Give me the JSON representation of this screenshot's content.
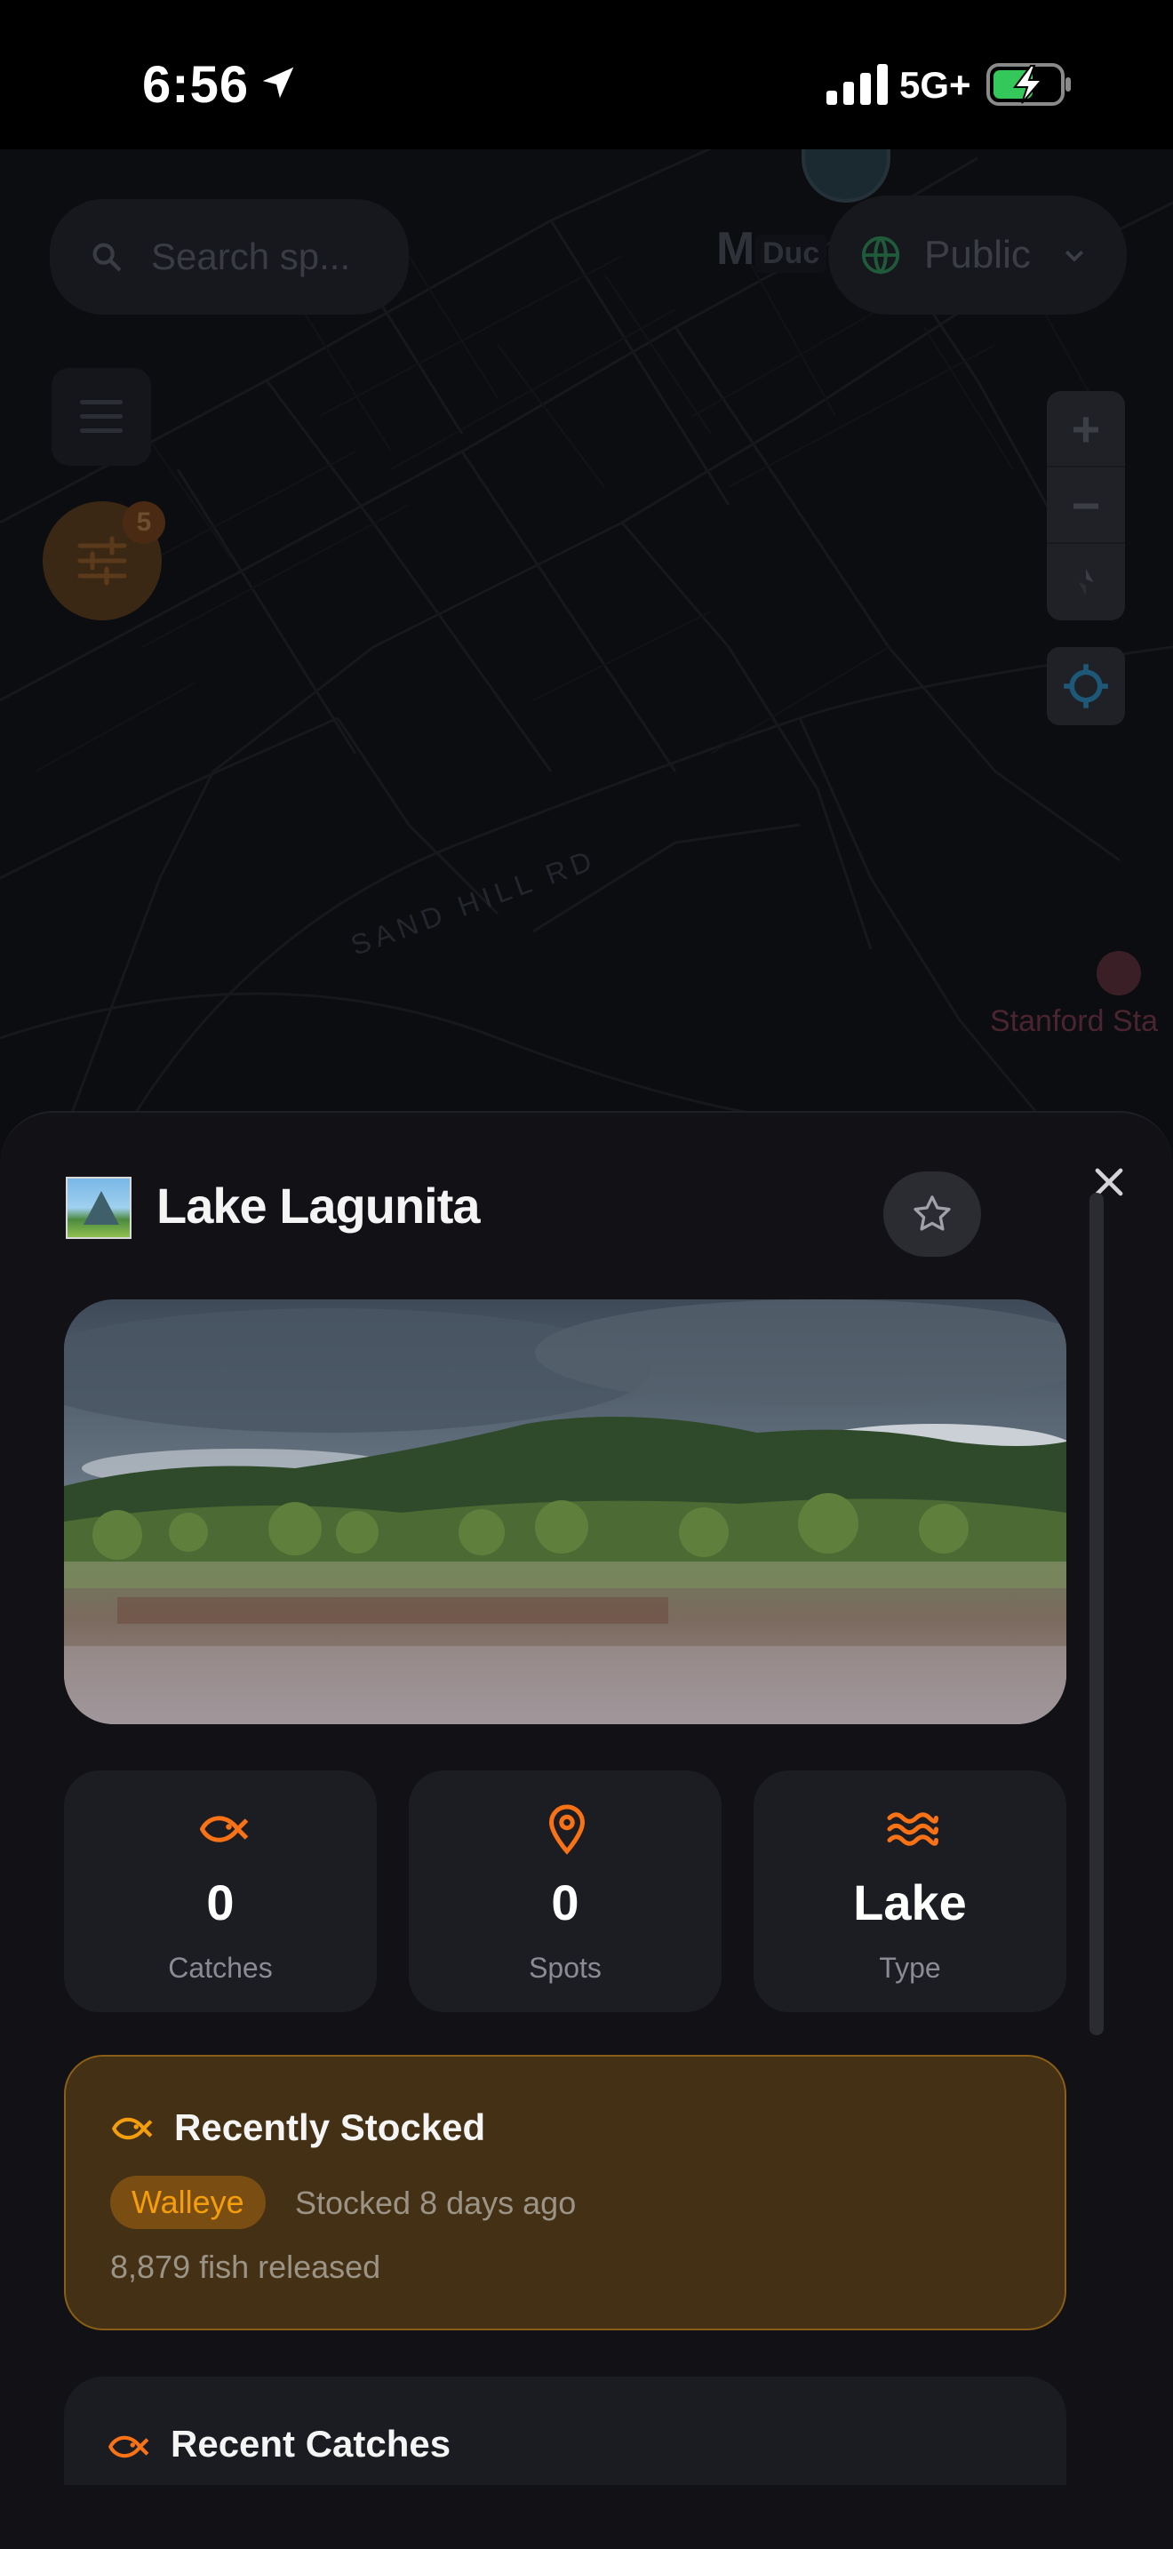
{
  "status_bar": {
    "time": "6:56",
    "network": "5G+"
  },
  "map": {
    "search_placeholder": "Search sp...",
    "visibility_label": "Public",
    "filter_count": "5",
    "label_md": "M",
    "label_duc": "Duc",
    "road_label": "SAND HILL RD",
    "poi_label": "Stanford Sta"
  },
  "sheet": {
    "title": "Lake Lagunita",
    "stats": [
      {
        "value": "0",
        "label": "Catches",
        "icon": "fish-icon"
      },
      {
        "value": "0",
        "label": "Spots",
        "icon": "map-pin-icon"
      },
      {
        "value": "Lake",
        "label": "Type",
        "icon": "waves-icon"
      }
    ],
    "recently_stocked": {
      "title": "Recently Stocked",
      "species": "Walleye",
      "when": "Stocked 8 days ago",
      "released": "8,879 fish released"
    },
    "recent_catches": {
      "title": "Recent Catches"
    }
  },
  "colors": {
    "accent": "#f97316",
    "stocked_bg": "#443015",
    "stocked_border": "#8a5e16",
    "chip_text": "#f59e0b"
  }
}
